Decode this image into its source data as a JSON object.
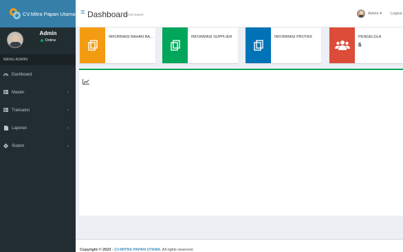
{
  "app": {
    "logo_text": "CV.Mitra Papan Utama"
  },
  "sidebar": {
    "user_name": "Admin",
    "user_status": "Online",
    "menu_header": "MENU ADMIN",
    "items": [
      {
        "label": "Dashboard",
        "icon": "dashboard-icon",
        "has_submenu": false
      },
      {
        "label": "Master",
        "icon": "table-icon",
        "has_submenu": true
      },
      {
        "label": "Transaksi",
        "icon": "table-icon",
        "has_submenu": true
      },
      {
        "label": "Laporan",
        "icon": "file-icon",
        "has_submenu": true
      },
      {
        "label": "Sistem",
        "icon": "gear-icon",
        "has_submenu": true
      }
    ]
  },
  "header": {
    "title": "Dashboard",
    "subtitle": "Control panel",
    "user_label": "Admin",
    "logout_label": "Logout"
  },
  "info_boxes": [
    {
      "text": "INFORMASI BAHAN BA...",
      "number": "",
      "color": "#f39c12",
      "icon": "copy-icon"
    },
    {
      "text": "INFORMASI SUPPLIER",
      "number": "",
      "color": "#00a65a",
      "icon": "copy-icon"
    },
    {
      "text": "INFORMASI PROYEK",
      "number": "",
      "color": "#0073b7",
      "icon": "copy-icon"
    },
    {
      "text": "PENGELOLA",
      "number": "6",
      "color": "#dd4b39",
      "icon": "users-icon"
    }
  ],
  "main": {
    "icon": "line-chart-icon",
    "accent_color": "#00a65a"
  },
  "footer": {
    "prefix": "Copyright © 2023 - ",
    "brand": "CV.MITRA PAPAN UTAMA.",
    "suffix": " All rights reserved."
  }
}
